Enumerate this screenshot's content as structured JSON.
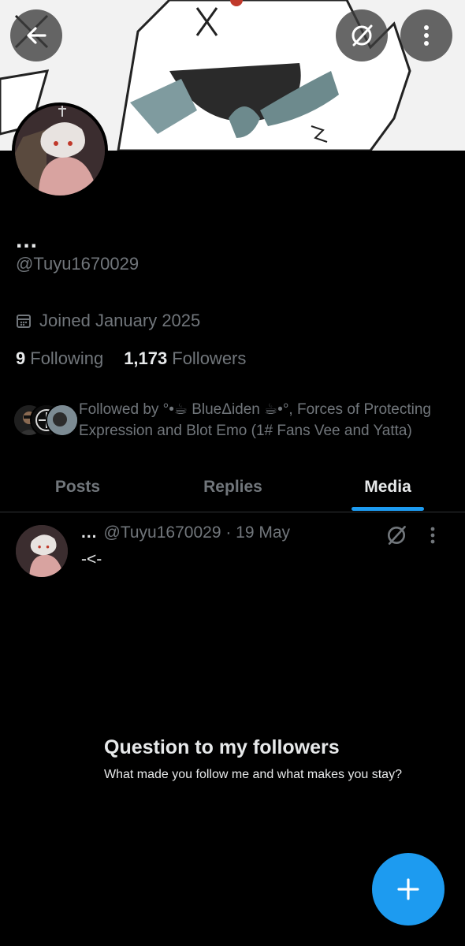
{
  "header": {
    "back_icon": "arrow-left-icon",
    "grok_icon": "grok-slash-icon",
    "more_icon": "more-vertical-icon"
  },
  "profile": {
    "display_name": "...",
    "handle": "@Tuyu1670029",
    "joined": "Joined January 2025",
    "following_count": "9",
    "following_label": "Following",
    "followers_count": "1,173",
    "followers_label": "Followers",
    "followed_by": "Followed by °•☕ BlueΔiden ☕•°, Forces of Protecting Expression and Blot Emo (1# Fans Vee and Yatta)"
  },
  "tabs": [
    {
      "label": "Posts",
      "active": false
    },
    {
      "label": "Replies",
      "active": false
    },
    {
      "label": "Media",
      "active": true
    }
  ],
  "post": {
    "display_name": "...",
    "meta": "@Tuyu1670029 · 19 May",
    "text": "-<-",
    "image_title": "Question to my followers",
    "image_body": "What made you follow me and what makes you stay?"
  },
  "fab": {
    "icon": "plus-icon"
  },
  "colors": {
    "accent": "#1d9bf0",
    "muted": "#71767b",
    "text": "#e7e9ea",
    "background": "#000000"
  }
}
